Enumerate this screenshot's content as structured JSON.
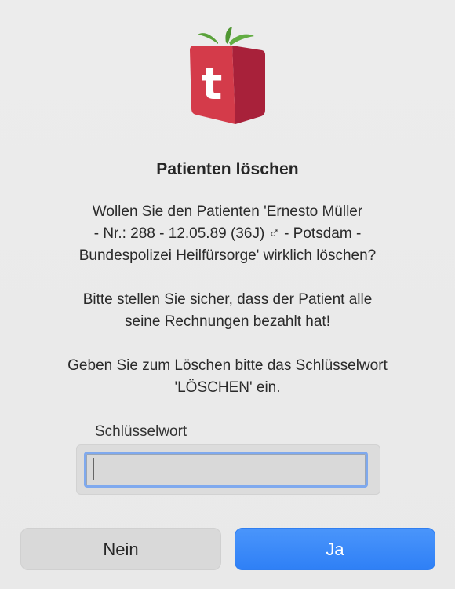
{
  "dialog": {
    "title": "Patienten löschen",
    "message_lines": [
      "Wollen Sie den Patienten 'Ernesto Müller",
      "- Nr.: 288 - 12.05.89 (36J) ♂ - Potsdam -",
      "Bundespolizei Heilfürsorge' wirklich löschen?"
    ],
    "warning_lines": [
      "Bitte stellen Sie sicher, dass der Patient alle",
      "seine Rechnungen bezahlt hat!"
    ],
    "instruction_lines": [
      "Geben Sie zum Löschen bitte das Schlüsselwort",
      "'LÖSCHEN' ein."
    ],
    "field": {
      "label": "Schlüsselwort",
      "value": "",
      "placeholder": ""
    },
    "buttons": {
      "no_label": "Nein",
      "yes_label": "Ja"
    }
  },
  "app_icon": {
    "name": "app-logo-icon",
    "letter": "t",
    "colors": {
      "front": "#d43b4a",
      "side": "#a8213a",
      "leaf": "#5aa23a"
    }
  },
  "colors": {
    "background": "#ebebeb",
    "primary_button": "#3385f7",
    "secondary_button": "#d9d9d9",
    "focus_ring": "#7fa9ee"
  }
}
